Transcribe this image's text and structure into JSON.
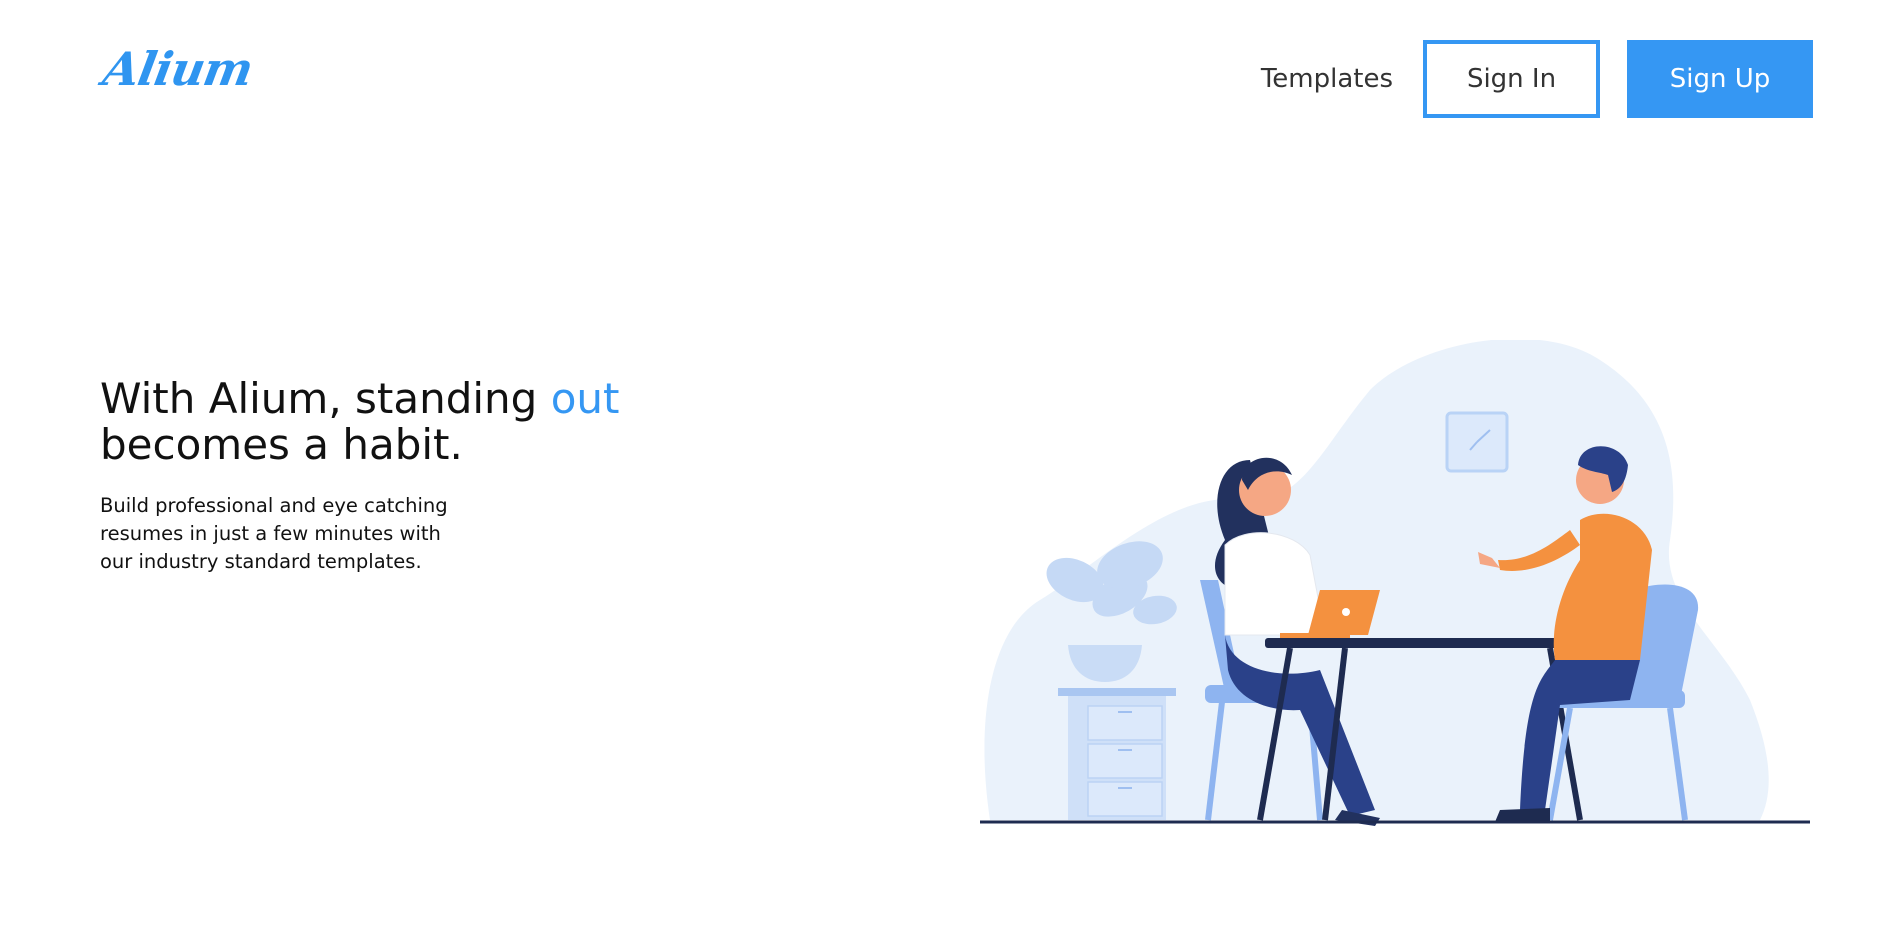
{
  "brand": {
    "logo_text": "Alium",
    "accent_color": "#3597f3"
  },
  "nav": {
    "templates_label": "Templates",
    "sign_in_label": "Sign In",
    "sign_up_label": "Sign Up"
  },
  "hero": {
    "title_part1": "With Alium, standing ",
    "title_accent": "out",
    "title_part2": "becomes a habit.",
    "description": "Build professional and eye catching resumes in just a few minutes with our industry standard templates."
  },
  "illustration": {
    "name": "two-people-meeting-illustration"
  }
}
